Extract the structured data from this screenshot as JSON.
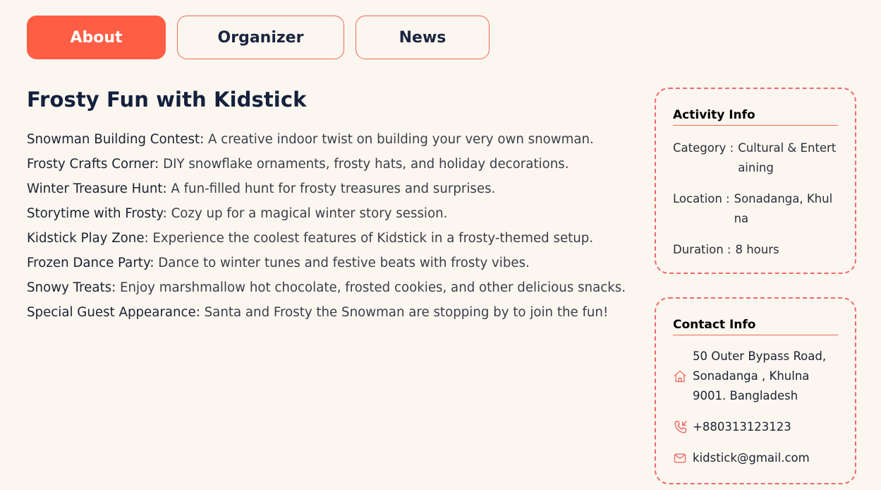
{
  "tabs": [
    {
      "label": "About",
      "active": true
    },
    {
      "label": "Organizer",
      "active": false
    },
    {
      "label": "News",
      "active": false
    }
  ],
  "main": {
    "title": "Frosty Fun with Kidstick",
    "activities": [
      {
        "name": "Snowman Building Contest:",
        "desc": " A creative indoor twist on building your very own snowman."
      },
      {
        "name": "Frosty Crafts Corner:",
        "desc": " DIY snowflake ornaments, frosty hats, and holiday decorations."
      },
      {
        "name": "Winter Treasure Hunt:",
        "desc": " A fun-filled hunt for frosty treasures and surprises."
      },
      {
        "name": "Storytime with Frosty",
        "desc": ": Cozy up for a magical winter story session."
      },
      {
        "name": "Kidstick Play Zone",
        "desc": ": Experience the coolest features of Kidstick in a frosty-themed setup."
      },
      {
        "name": "Frozen Dance Party:",
        "desc": " Dance to winter tunes and festive beats with frosty vibes."
      },
      {
        "name": "Snowy Treats:",
        "desc": " Enjoy marshmallow hot chocolate, frosted cookies, and other delicious snacks."
      },
      {
        "name": "Special Guest Appearance:",
        "desc": " Santa and Frosty the Snowman are stopping by to join the fun!"
      }
    ]
  },
  "activity_info": {
    "title": "Activity Info",
    "category_label": "Category :",
    "category_value": "Cultural & Entertaining",
    "location_label": "Location :",
    "location_value": "Sonadanga, Khulna",
    "duration_label": "Duration :",
    "duration_value": "8 hours"
  },
  "contact_info": {
    "title": "Contact Info",
    "address": "50 Outer Bypass Road, Sonadanga , Khulna 9001. Bangladesh",
    "phone": "+880313123123",
    "email": "kidstick@gmail.com",
    "icons": {
      "address": "home-icon",
      "phone": "phone-icon",
      "email": "mail-icon"
    }
  },
  "colors": {
    "accent": "#ff5e45",
    "border": "#f06a6a",
    "background": "#fbf6ef",
    "heading": "#14213d"
  }
}
